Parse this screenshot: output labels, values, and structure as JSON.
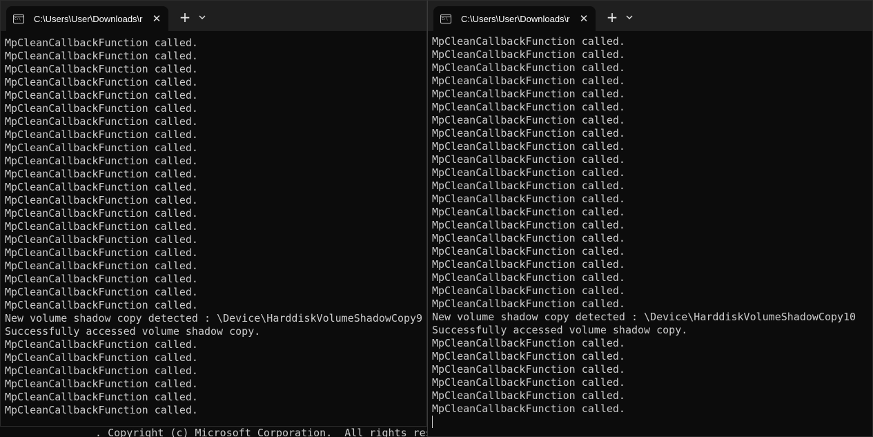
{
  "background": {
    "partial_text": "  . Copyright (c) Microsoft Corporation.  All rights reserved."
  },
  "left_window": {
    "tab_title": "C:\\Users\\User\\Downloads\\r",
    "close_symbol": "✕",
    "new_tab_symbol": "+",
    "lines": [
      "MpCleanCallbackFunction called.",
      "MpCleanCallbackFunction called.",
      "MpCleanCallbackFunction called.",
      "MpCleanCallbackFunction called.",
      "MpCleanCallbackFunction called.",
      "MpCleanCallbackFunction called.",
      "MpCleanCallbackFunction called.",
      "MpCleanCallbackFunction called.",
      "MpCleanCallbackFunction called.",
      "MpCleanCallbackFunction called.",
      "MpCleanCallbackFunction called.",
      "MpCleanCallbackFunction called.",
      "MpCleanCallbackFunction called.",
      "MpCleanCallbackFunction called.",
      "MpCleanCallbackFunction called.",
      "MpCleanCallbackFunction called.",
      "MpCleanCallbackFunction called.",
      "MpCleanCallbackFunction called.",
      "MpCleanCallbackFunction called.",
      "MpCleanCallbackFunction called.",
      "MpCleanCallbackFunction called.",
      "New volume shadow copy detected : \\Device\\HarddiskVolumeShadowCopy9",
      "Successfully accessed volume shadow copy.",
      "MpCleanCallbackFunction called.",
      "MpCleanCallbackFunction called.",
      "MpCleanCallbackFunction called.",
      "MpCleanCallbackFunction called.",
      "MpCleanCallbackFunction called.",
      "MpCleanCallbackFunction called."
    ]
  },
  "right_window": {
    "tab_title": "C:\\Users\\User\\Downloads\\r",
    "close_symbol": "✕",
    "new_tab_symbol": "+",
    "lines": [
      "MpCleanCallbackFunction called.",
      "MpCleanCallbackFunction called.",
      "MpCleanCallbackFunction called.",
      "MpCleanCallbackFunction called.",
      "MpCleanCallbackFunction called.",
      "MpCleanCallbackFunction called.",
      "MpCleanCallbackFunction called.",
      "MpCleanCallbackFunction called.",
      "MpCleanCallbackFunction called.",
      "MpCleanCallbackFunction called.",
      "MpCleanCallbackFunction called.",
      "MpCleanCallbackFunction called.",
      "MpCleanCallbackFunction called.",
      "MpCleanCallbackFunction called.",
      "MpCleanCallbackFunction called.",
      "MpCleanCallbackFunction called.",
      "MpCleanCallbackFunction called.",
      "MpCleanCallbackFunction called.",
      "MpCleanCallbackFunction called.",
      "MpCleanCallbackFunction called.",
      "MpCleanCallbackFunction called.",
      "New volume shadow copy detected : \\Device\\HarddiskVolumeShadowCopy10",
      "Successfully accessed volume shadow copy.",
      "MpCleanCallbackFunction called.",
      "MpCleanCallbackFunction called.",
      "MpCleanCallbackFunction called.",
      "MpCleanCallbackFunction called.",
      "MpCleanCallbackFunction called.",
      "MpCleanCallbackFunction called."
    ]
  },
  "icons": {
    "tab_icon": "terminal-icon",
    "close": "close-icon",
    "new_tab": "plus-icon",
    "dropdown": "chevron-down-icon"
  },
  "colors": {
    "terminal_bg": "#0c0c0c",
    "titlebar_bg": "#1f1f1f",
    "text": "#cccccc"
  }
}
